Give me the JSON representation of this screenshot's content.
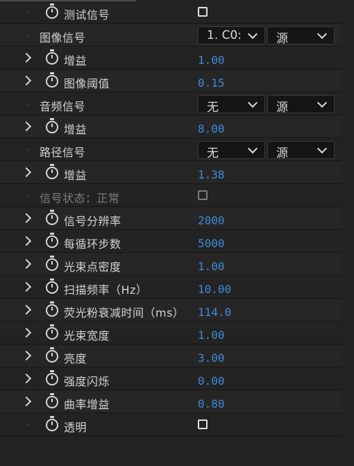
{
  "colors": {
    "panel_background": "#232323",
    "value_blue": "#3f8ad8",
    "label_text": "#d3d3d3",
    "dim_text": "#7e7e7e"
  },
  "icons": {
    "stopwatch": "stopwatch-icon",
    "expand": "chevron-right-icon",
    "dropdown": "chevron-down-icon"
  },
  "rows": {
    "test_signal": {
      "label": "测试信号"
    },
    "image_signal": {
      "label": "图像信号",
      "select1": "1. C0:",
      "select2": "源"
    },
    "image_gain": {
      "label": "增益",
      "value": "1.00"
    },
    "image_threshold": {
      "label": "图像阈值",
      "value": "0.15"
    },
    "audio_signal": {
      "label": "音频信号",
      "select1": "无",
      "select2": "源"
    },
    "audio_gain": {
      "label": "增益",
      "value": "8.00"
    },
    "path_signal": {
      "label": "路径信号",
      "select1": "无",
      "select2": "源"
    },
    "path_gain": {
      "label": "增益",
      "value": "1.38"
    },
    "signal_status": {
      "label": "信号状态：正常"
    },
    "signal_resolution": {
      "label": "信号分辨率",
      "value": "2000"
    },
    "steps_per_cycle": {
      "label": "每循环步数",
      "value": "5000"
    },
    "beam_point_density": {
      "label": "光束点密度",
      "value": "1.00"
    },
    "scan_frequency": {
      "label": "扫描频率（Hz）",
      "value": "10.00"
    },
    "phosphor_decay": {
      "label": "荧光粉衰减时间（ms）",
      "value": "114.0"
    },
    "beam_width": {
      "label": "光束宽度",
      "value": "1.00"
    },
    "brightness": {
      "label": "亮度",
      "value": "3.00"
    },
    "intensity_flicker": {
      "label": "强度闪烁",
      "value": "0.00"
    },
    "curvature_gain": {
      "label": "曲率增益",
      "value": "0.80"
    },
    "transparent": {
      "label": "透明"
    }
  }
}
